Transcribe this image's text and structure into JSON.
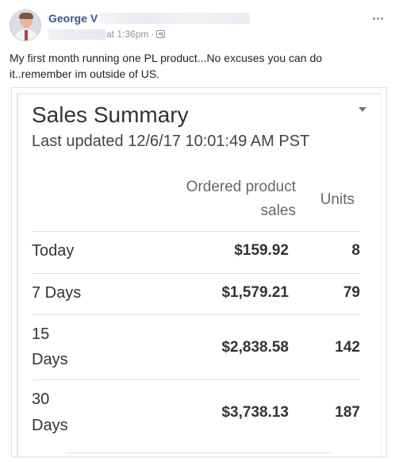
{
  "post": {
    "author": "George V",
    "timestamp": "at 1:36pm",
    "separator": "·",
    "text": "My first month running one PL product...No excuses you can do it..remember im outside of US."
  },
  "summary": {
    "title": "Sales Summary",
    "last_updated": "Last updated 12/6/17 10:01:49 AM PST",
    "columns": {
      "sales_line1": "Ordered product",
      "sales_line2": "sales",
      "units": "Units"
    },
    "rows": [
      {
        "label_line1": "Today",
        "label_line2": "",
        "sales": "$159.92",
        "units": "8"
      },
      {
        "label_line1": "7 Days",
        "label_line2": "",
        "sales": "$1,579.21",
        "units": "79"
      },
      {
        "label_line1": "15",
        "label_line2": "Days",
        "sales": "$2,838.58",
        "units": "142"
      },
      {
        "label_line1": "30",
        "label_line2": "Days",
        "sales": "$3,738.13",
        "units": "187"
      }
    ]
  },
  "icons": {
    "options": "more-horizontal-icon",
    "audience": "audience-icon",
    "dropdown": "caret-down-icon"
  },
  "colors": {
    "link": "#365899",
    "meta": "#90949c",
    "text": "#1d2129"
  }
}
